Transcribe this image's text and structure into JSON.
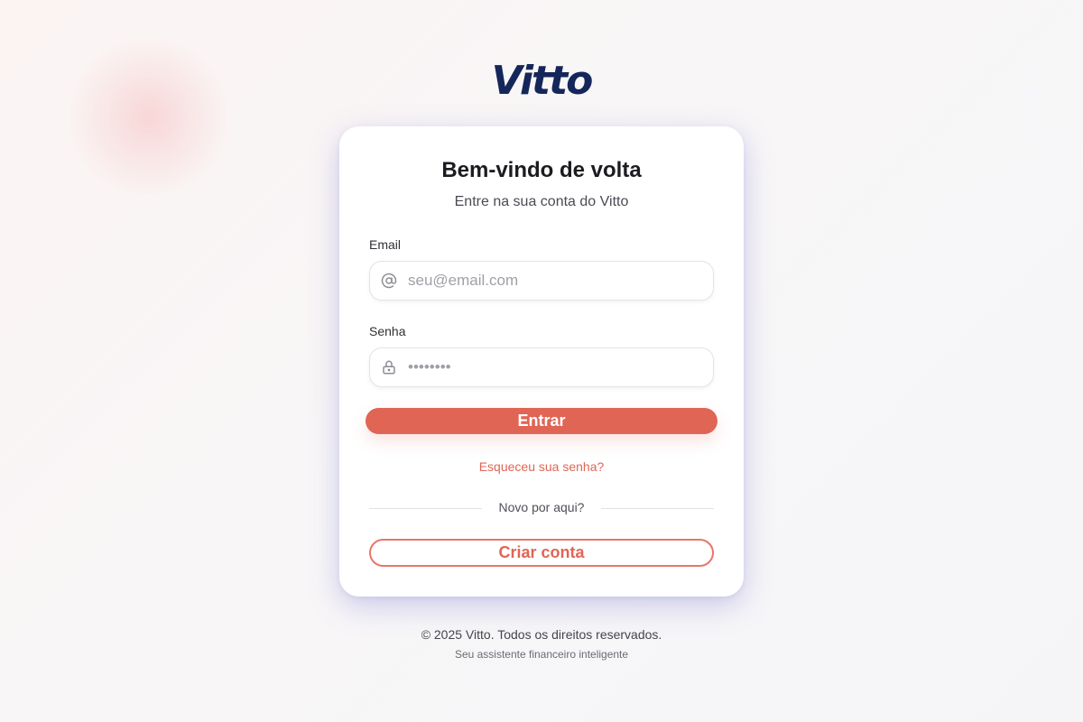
{
  "brand": {
    "name": "Vitto",
    "accent_color": "#e06555",
    "logo_color": "#15265a"
  },
  "login_card": {
    "title": "Bem-vindo de volta",
    "subtitle": "Entre na sua conta do Vitto",
    "email": {
      "label": "Email",
      "placeholder": "seu@email.com",
      "value": "",
      "icon": "at-sign-icon"
    },
    "password": {
      "label": "Senha",
      "placeholder": "••••••••",
      "value": "",
      "icon": "lock-icon"
    },
    "submit_label": "Entrar",
    "forgot_link": "Esqueceu sua senha?",
    "divider_text": "Novo por aqui?",
    "signup_label": "Criar conta"
  },
  "footer": {
    "copyright": "© 2025 Vitto. Todos os direitos reservados.",
    "tagline": "Seu assistente financeiro inteligente"
  }
}
